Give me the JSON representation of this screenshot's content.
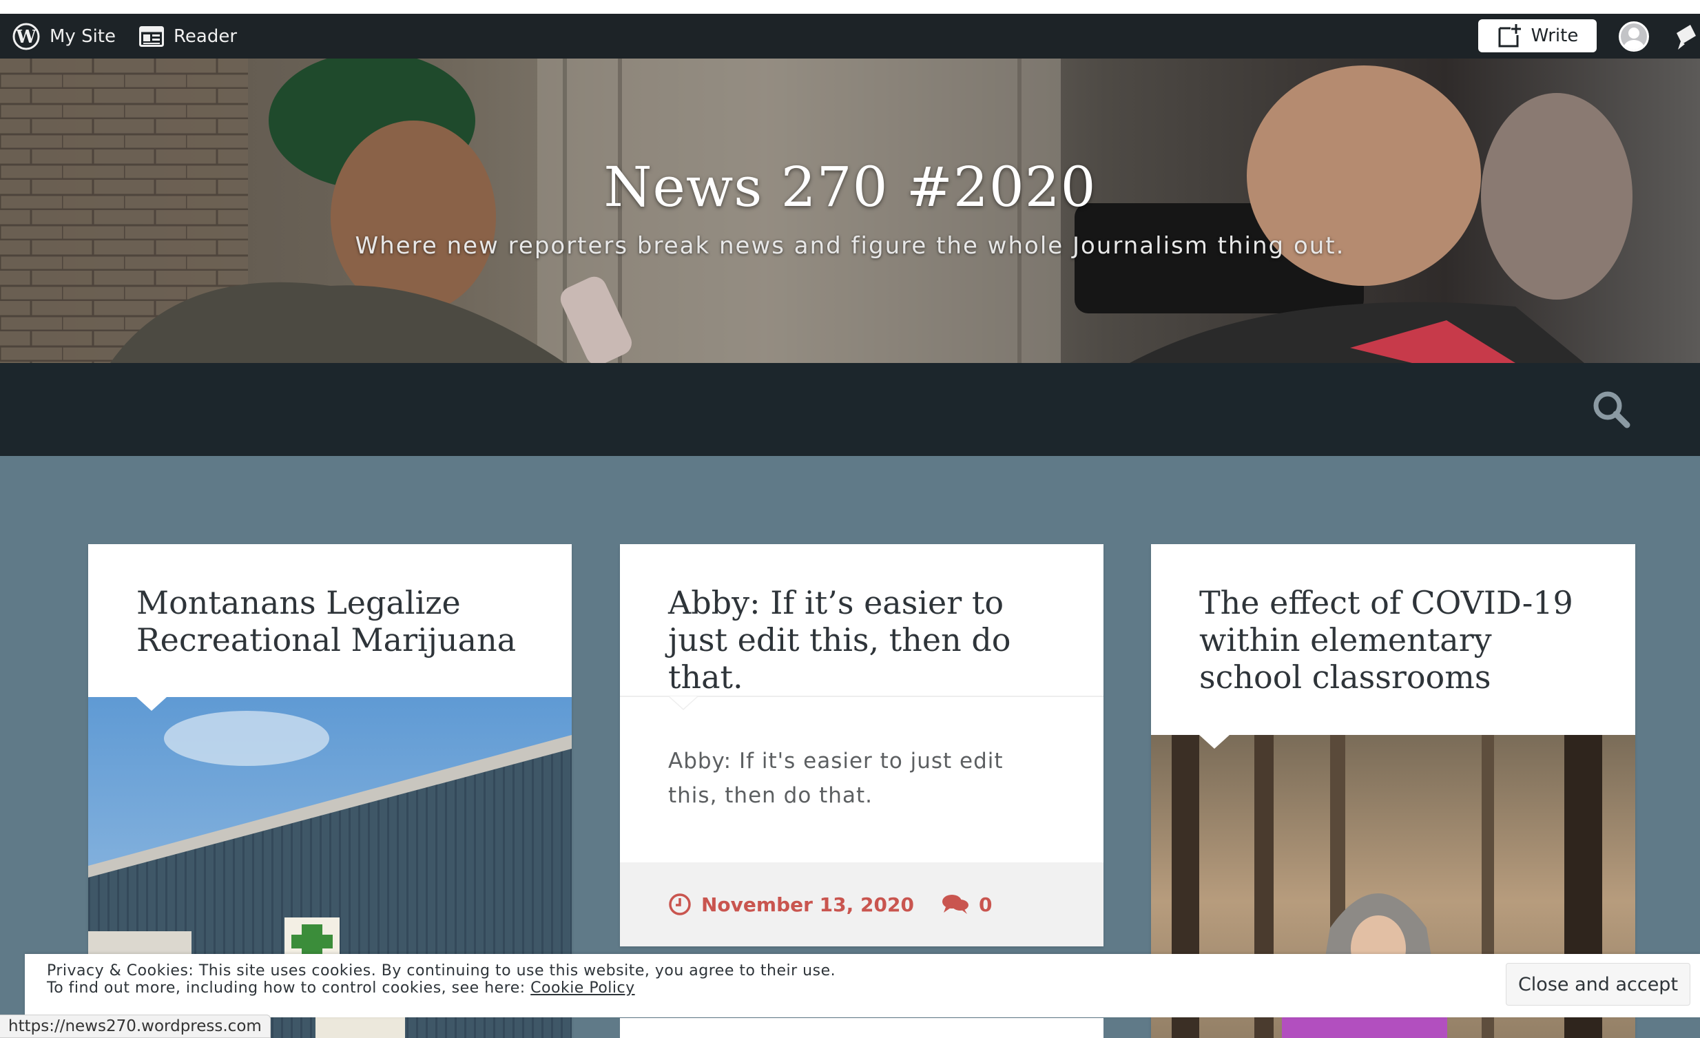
{
  "adminbar": {
    "mysite_label": "My Site",
    "reader_label": "Reader",
    "write_label": "Write",
    "icons": [
      "wordpress-logo-icon",
      "reader-icon",
      "write-icon",
      "avatar",
      "notifications-icon"
    ]
  },
  "header": {
    "title": "News 270 #2020",
    "description": "Where new reporters break news and figure the whole Journalism thing out."
  },
  "posts": [
    {
      "title": "Montanans Legalize Recreational Marijuana"
    },
    {
      "title": "Abby: If it’s easier to just edit this, then do that.",
      "excerpt": "Abby: If it's easier to just edit this, then do that.",
      "date": "November 13, 2020",
      "comments": "0"
    },
    {
      "title": "The effect of COVID-19 within elementary school classrooms"
    }
  ],
  "cookie": {
    "line1": "Privacy & Cookies: This site uses cookies. By continuing to use this website, you agree to their use.",
    "line2": "To find out more, including how to control cookies, see here: ",
    "link": "Cookie Policy",
    "button": "Close and accept"
  },
  "status_url": "https://news270.wordpress.com",
  "colors": {
    "adminbar": "#1d2327",
    "navbar": "#1c262c",
    "page_bg": "#607a88",
    "accent": "#c9554f"
  }
}
